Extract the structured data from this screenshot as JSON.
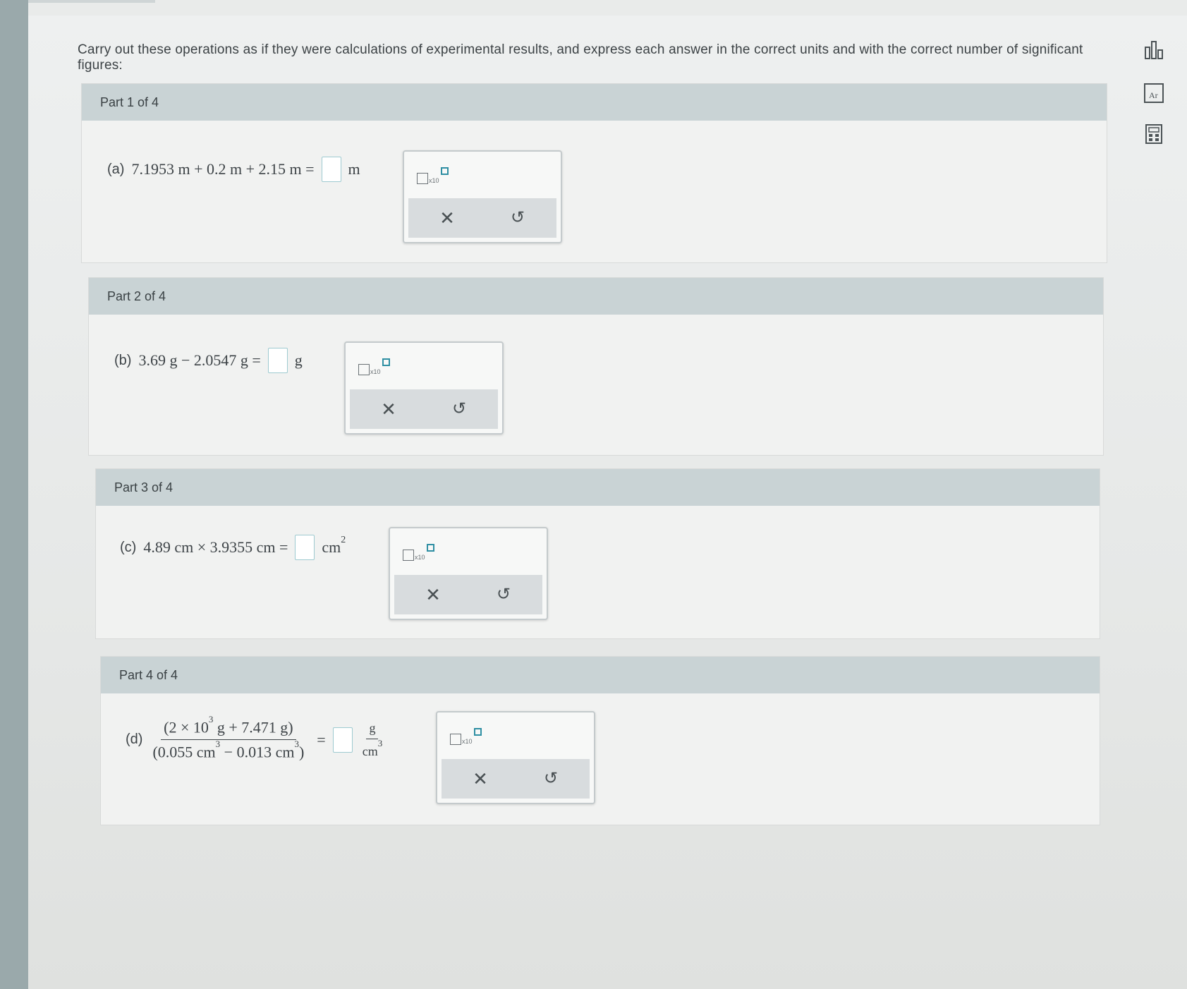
{
  "instructions": "Carry out these operations as if they were calculations of experimental results, and express each answer in the correct units and with the correct number of significant figures:",
  "parts": [
    {
      "header": "Part 1 of 4",
      "letter": "(a)",
      "expression": "7.1953 m + 0.2 m + 2.15 m  =",
      "unit": "m"
    },
    {
      "header": "Part 2 of 4",
      "letter": "(b)",
      "expression": "3.69 g − 2.0547 g  =",
      "unit": "g"
    },
    {
      "header": "Part 3 of 4",
      "letter": "(c)",
      "expression": "4.89 cm × 3.9355 cm  =",
      "unit": "cm",
      "unit_exp": "2"
    },
    {
      "header": "Part 4 of 4",
      "letter": "(d)",
      "numerator_a": "(2 × 10",
      "numerator_exp": "3",
      "numerator_b": " g + 7.471 g)",
      "denominator_a": "(0.055 cm",
      "denominator_exp1": "3",
      "denominator_b": " − 0.013 cm",
      "denominator_exp2": "3",
      "denominator_c": ")",
      "equals": "=",
      "unit_num": "g",
      "unit_den": "cm",
      "unit_den_exp": "3"
    }
  ],
  "tool": {
    "x10_label": "x10",
    "clear_symbol": "✕",
    "undo_symbol": "↺"
  },
  "side_icons": [
    "chart-icon",
    "periodic-table-icon",
    "calculator-icon"
  ]
}
